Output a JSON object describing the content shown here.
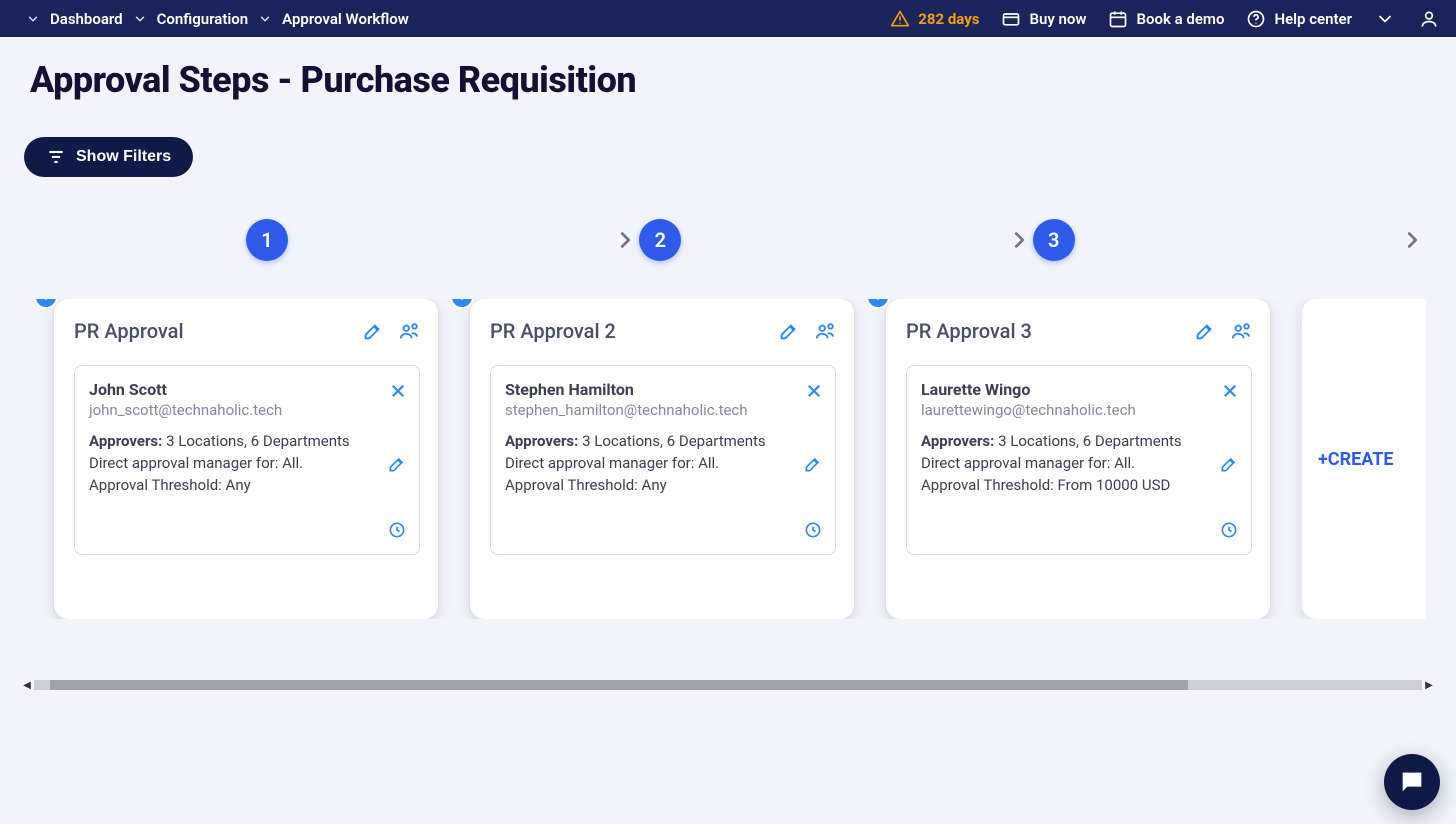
{
  "breadcrumb": {
    "items": [
      "Dashboard",
      "Configuration",
      "Approval Workflow"
    ]
  },
  "nav": {
    "days": "282 days",
    "buy": "Buy now",
    "demo": "Book a demo",
    "help": "Help center"
  },
  "page": {
    "title": "Approval Steps - Purchase Requisition",
    "filters_label": "Show Filters"
  },
  "steps": [
    {
      "number": "1"
    },
    {
      "number": "2"
    },
    {
      "number": "3"
    }
  ],
  "cards": [
    {
      "title": "PR Approval",
      "approver": {
        "name": "John Scott",
        "email": "john_scott@technaholic.tech",
        "approvers_label": "Approvers:",
        "approvers_value": "3 Locations, 6 Departments",
        "manager_line": "Direct approval manager for: All.",
        "threshold_line": "Approval Threshold: Any"
      }
    },
    {
      "title": "PR Approval 2",
      "approver": {
        "name": "Stephen Hamilton",
        "email": "stephen_hamilton@technaholic.tech",
        "approvers_label": "Approvers:",
        "approvers_value": "3 Locations, 6 Departments",
        "manager_line": "Direct approval manager for: All.",
        "threshold_line": "Approval Threshold: Any"
      }
    },
    {
      "title": "PR Approval 3",
      "approver": {
        "name": "Laurette Wingo",
        "email": "laurettewingo@technaholic.tech",
        "approvers_label": "Approvers:",
        "approvers_value": "3 Locations, 6 Departments",
        "manager_line": "Direct approval manager for: All.",
        "threshold_line": "Approval Threshold: From 10000 USD"
      }
    }
  ],
  "create_label": "+CREATE"
}
